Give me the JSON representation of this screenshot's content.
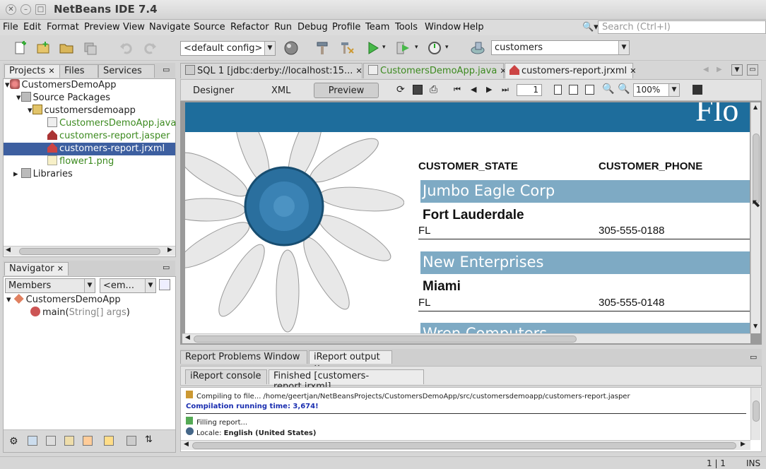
{
  "window": {
    "title": "NetBeans IDE 7.4"
  },
  "menubar": {
    "items": [
      "File",
      "Edit",
      "Format",
      "Preview",
      "View",
      "Navigate",
      "Source",
      "Refactor",
      "Run",
      "Debug",
      "Profile",
      "Team",
      "Tools",
      "Window",
      "Help"
    ],
    "search_placeholder": "Search (Ctrl+I)"
  },
  "toolbar": {
    "config_combo": "<default config>",
    "datasource_combo": "customers"
  },
  "projects_panel": {
    "tabs": [
      "Projects",
      "Files",
      "Services"
    ],
    "tree": {
      "project": "CustomersDemoApp",
      "source_packages": "Source Packages",
      "package": "customersdemoapp",
      "files": [
        "CustomersDemoApp.java",
        "customers-report.jasper",
        "customers-report.jrxml",
        "flower1.png"
      ],
      "libraries": "Libraries"
    }
  },
  "navigator": {
    "tab": "Navigator",
    "members_combo": "Members",
    "filter_combo": "<em...",
    "class_name": "CustomersDemoApp",
    "method": "main(",
    "method_params": "String[] args",
    "method_close": ")"
  },
  "editor": {
    "tabs": [
      "SQL 1 [jdbc:derby://localhost:15...",
      "CustomersDemoApp.java",
      "customers-report.jrxml"
    ],
    "view_tabs": [
      "Designer",
      "XML",
      "Preview"
    ],
    "page_field": "1",
    "zoom": "100%"
  },
  "report": {
    "header_partial": "Flo",
    "col_headers": [
      "CUSTOMER_STATE",
      "CUSTOMER_PHONE"
    ],
    "records": [
      {
        "company": "Jumbo Eagle Corp",
        "city": "Fort Lauderdale",
        "state": "FL",
        "phone": "305-555-0188"
      },
      {
        "company": "New Enterprises",
        "city": "Miami",
        "state": "FL",
        "phone": "305-555-0148"
      }
    ],
    "partial_next": "Wren Computers"
  },
  "output_panel": {
    "tabs": [
      "Report Problems Window",
      "iReport output"
    ],
    "subtabs": [
      "iReport console",
      "Finished [customers-report.jrxml]"
    ],
    "lines": {
      "compiling": "Compiling to file... /home/geertjan/NetBeansProjects/CustomersDemoApp/src/customersdemoapp/customers-report.jasper",
      "compile_time": "Compilation running time: 3,674!",
      "filling": "Filling report...",
      "locale_label": "Locale:",
      "locale_value": "English (United States)"
    }
  },
  "statusbar": {
    "position": "1 | 1",
    "mode": "INS"
  },
  "colors": {
    "report_band": "#7eaac4",
    "report_header": "#1e6d9c",
    "selection": "#3d5fa0",
    "green_file": "#3c8a1f"
  }
}
